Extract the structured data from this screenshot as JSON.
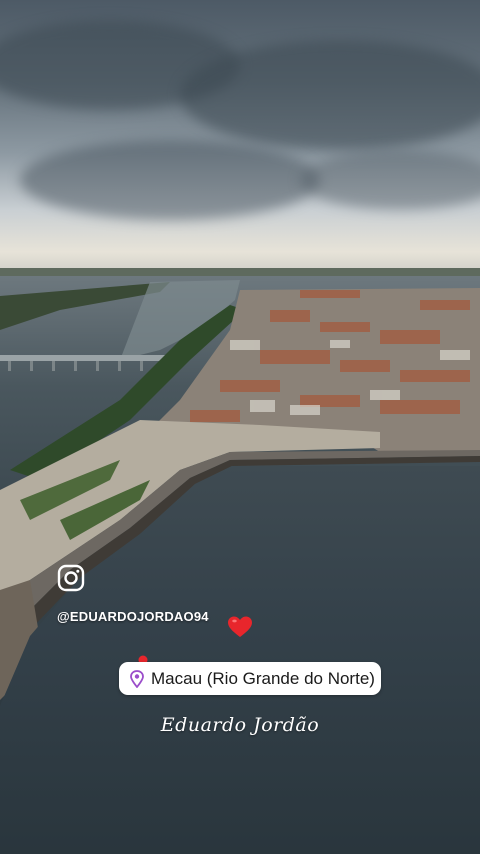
{
  "story": {
    "social_icon": "instagram-icon",
    "handle": "@EDUARDOJORDAO94",
    "reaction_icon": "heart-icon",
    "location_sticker": {
      "icon": "map-pin-icon",
      "label": "Macau (Rio Grande do Norte)"
    },
    "signature": "Eduardo Jordão"
  },
  "colors": {
    "heart": "#e8262c",
    "pin": "#9b4dca",
    "pin_top": "#e8262c"
  }
}
